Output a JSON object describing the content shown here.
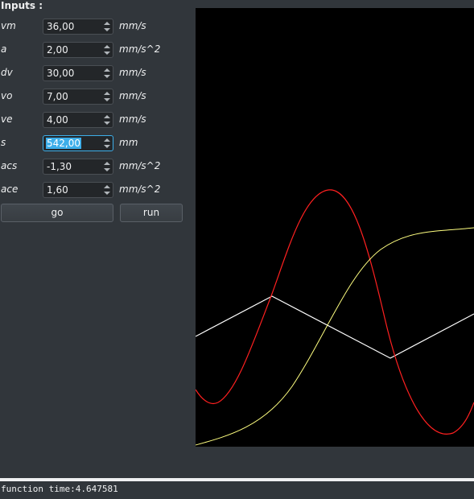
{
  "panel": {
    "title": "Inputs :"
  },
  "inputs": [
    {
      "label": "vm",
      "value": "36,00",
      "unit": "mm/s"
    },
    {
      "label": "a",
      "value": "2,00",
      "unit": "mm/s^2"
    },
    {
      "label": "dv",
      "value": "30,00",
      "unit": "mm/s"
    },
    {
      "label": "vo",
      "value": "7,00",
      "unit": "mm/s"
    },
    {
      "label": "ve",
      "value": "4,00",
      "unit": "mm/s"
    },
    {
      "label": "s",
      "value": "542,00",
      "unit": "mm",
      "focused": true
    },
    {
      "label": "acs",
      "value": "-1,30",
      "unit": "mm/s^2"
    },
    {
      "label": "ace",
      "value": "1,60",
      "unit": "mm/s^2"
    }
  ],
  "buttons": {
    "go_label": "go",
    "run_label": "run"
  },
  "status": {
    "text": "function time:4.647581"
  },
  "colors": {
    "background": "#31363b",
    "plot_background": "#000000",
    "red_curve": "#ff2020",
    "yellow_curve": "#ffff80",
    "white_curve": "#ffffff",
    "focus": "#3daee9"
  }
}
